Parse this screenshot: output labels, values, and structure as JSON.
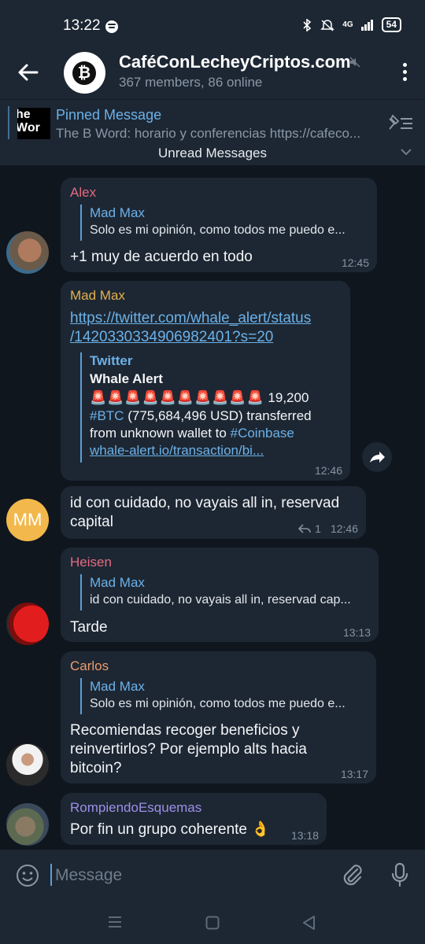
{
  "status_bar": {
    "time": "13:22",
    "network": "4G",
    "battery": "54"
  },
  "header": {
    "title": "CaféConLecheyCriptos.com",
    "subtitle": "367 members, 86 online"
  },
  "pinned": {
    "label": "Pinned Message",
    "thumb_lines": [
      "he",
      "Wor"
    ],
    "text": "The B Word: horario y conferencias https://cafeco..."
  },
  "unread_label": "Unread Messages",
  "messages": [
    {
      "sender": "Alex",
      "reply_to": "Mad Max",
      "reply_text": "Solo es mi opinión, como todos me puedo e...",
      "text": "+1 muy de acuerdo en todo",
      "time": "12:45"
    },
    {
      "sender": "Mad Max",
      "link_line1": "https://twitter.com/whale_alert/status",
      "link_line2": "/1420330334906982401?s=20",
      "preview_site": "Twitter",
      "preview_title": "Whale Alert",
      "preview_amount": "19,200",
      "preview_hashtag1": "#BTC",
      "preview_usd": "(775,684,496 USD) transferred",
      "preview_line3": "from unknown wallet to",
      "preview_hashtag2": "#Coinbase",
      "preview_link": "whale-alert.io/transaction/bi...",
      "time": "12:46"
    },
    {
      "avatar_initials": "MM",
      "text_line1": "id con cuidado, no vayais all in, reservad",
      "text_line2": "capital",
      "reply_count": "1",
      "time": "12:46"
    },
    {
      "sender": "Heisen",
      "reply_to": "Mad Max",
      "reply_text": "id con cuidado, no vayais all in, reservad cap...",
      "text": "Tarde",
      "time": "13:13"
    },
    {
      "sender": "Carlos",
      "reply_to": "Mad Max",
      "reply_text": "Solo es mi opinión, como todos me puedo e...",
      "text_line1": "Recomiendas recoger beneficios y",
      "text_line2": "reinvertirlos? Por ejemplo alts hacia",
      "text_line3": "bitcoin?",
      "time": "13:17"
    },
    {
      "sender": "RompiendoEsquemas",
      "text": "Por fin un grupo coherente 👌",
      "time": "13:18"
    }
  ],
  "composer": {
    "placeholder": "Message"
  },
  "colors": {
    "background": "#0f161e",
    "bubble": "#1d2733",
    "link": "#6cb1e8",
    "alex": "#e56a80",
    "madmax": "#e3b14f",
    "heisen": "#e56a80",
    "carlos": "#ef9a6b",
    "rompiendo": "#9e8fe8"
  }
}
